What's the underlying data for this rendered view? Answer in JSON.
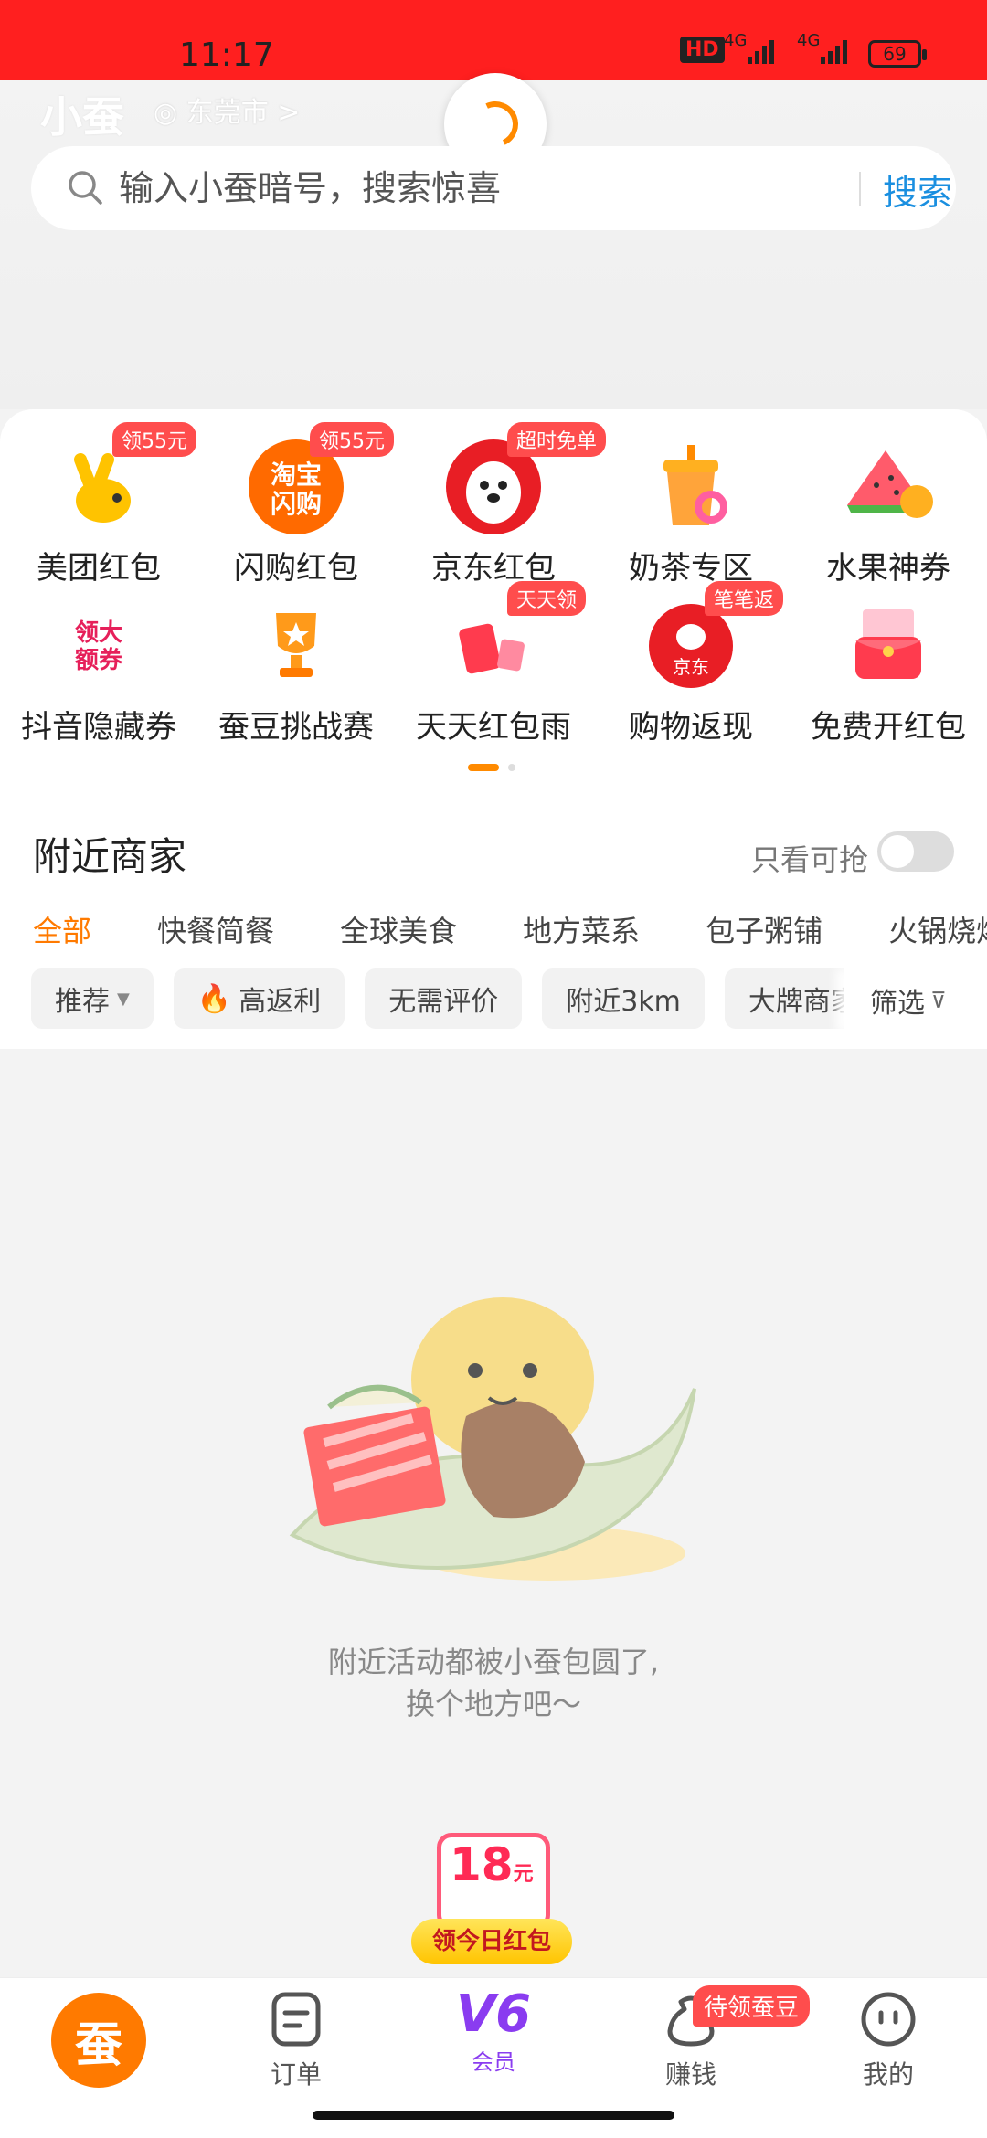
{
  "status_bar": {
    "time": "11:17",
    "hd_label": "HD",
    "network_1": "4G",
    "network_2": "4G",
    "battery": "69"
  },
  "header": {
    "logo": "小蚕",
    "location": "东莞市 >",
    "search_placeholder": "输入小蚕暗号，搜索惊喜",
    "search_button": "搜索"
  },
  "categories": [
    {
      "label": "美团红包",
      "badge": "领55元",
      "icon": "meituan-icon"
    },
    {
      "label": "闪购红包",
      "badge": "领55元",
      "icon": "taobao-flash-icon"
    },
    {
      "label": "京东红包",
      "badge": "超时免单",
      "icon": "jd-dog-icon"
    },
    {
      "label": "奶茶专区",
      "badge": "",
      "icon": "milk-tea-icon"
    },
    {
      "label": "水果神券",
      "badge": "",
      "icon": "watermelon-icon"
    },
    {
      "label": "抖音隐藏券",
      "badge": "",
      "icon": "douyin-coupon-icon",
      "icon_text": "领大\n额券"
    },
    {
      "label": "蚕豆挑战赛",
      "badge": "",
      "icon": "trophy-icon"
    },
    {
      "label": "天天红包雨",
      "badge": "天天领",
      "icon": "red-envelope-rain-icon"
    },
    {
      "label": "购物返现",
      "badge": "笔笔返",
      "icon": "jd-cashback-icon",
      "icon_text": "京东"
    },
    {
      "label": "免费开红包",
      "badge": "",
      "icon": "gift-box-icon"
    }
  ],
  "nearby": {
    "title": "附近商家",
    "toggle_label": "只看可抢",
    "toggle_on": false,
    "tabs": [
      "全部",
      "快餐简餐",
      "全球美食",
      "地方菜系",
      "包子粥铺",
      "火锅烧烤"
    ],
    "active_tab": "全部",
    "chips": [
      "推荐",
      "高返利",
      "无需评价",
      "附近3km",
      "大牌商家"
    ],
    "filter_label": "筛选"
  },
  "empty_state": {
    "line1": "附近活动都被小蚕包圆了,",
    "line2": "换个地方吧～"
  },
  "red_packet": {
    "amount": "18",
    "unit": "元",
    "label": "领今日红包"
  },
  "bottom_nav": {
    "home_icon_text": "蚕",
    "orders": "订单",
    "vip_level": "V6",
    "vip_label": "会员",
    "earn": "赚钱",
    "earn_badge": "待领蚕豆",
    "mine": "我的"
  },
  "colors": {
    "status_bar": "#ff1f1f",
    "accent_orange": "#ff7a00",
    "search_blue": "#1a8fe0",
    "badge_red": "#ff4d4d",
    "vip_purple": "#8a3cf0"
  }
}
